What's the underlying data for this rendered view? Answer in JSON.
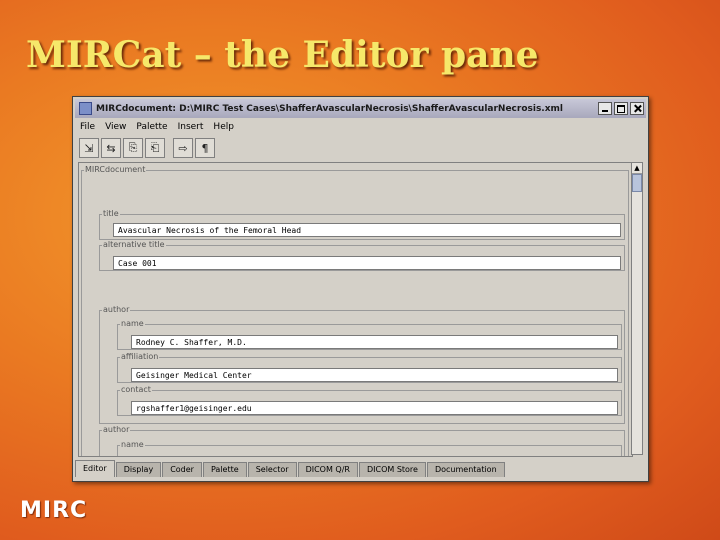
{
  "slide": {
    "title": "MIRCat – the Editor pane",
    "logo": "MIRC"
  },
  "window": {
    "title": "MIRCdocument: D:\\MIRC Test Cases\\ShafferAvascularNecrosis\\ShafferAvascularNecrosis.xml",
    "menus": [
      "File",
      "View",
      "Palette",
      "Insert",
      "Help"
    ],
    "toolbar_icons": [
      "insert-element-icon",
      "move-element-icon",
      "copy-icon",
      "paste-icon",
      "next-icon",
      "paragraph-icon"
    ],
    "toolbar_glyphs": [
      "⇲",
      "⇆",
      "⎘",
      "⎗",
      "⇨",
      "¶"
    ]
  },
  "editor": {
    "root_legend": "MIRCdocument",
    "title_legend": "title",
    "title_value": "Avascular Necrosis of the Femoral Head",
    "alt_title_legend": "alternative title",
    "alt_title_value": "Case 001",
    "author_legend": "author",
    "name_legend": "name",
    "name_value": "Rodney C. Shaffer, M.D.",
    "affiliation_legend": "affiliation",
    "affiliation_value": "Geisinger Medical Center",
    "contact_legend": "contact",
    "contact_value": "rgshaffer1@geisinger.edu",
    "author2_legend": "author",
    "name2_legend": "name"
  },
  "tabs": [
    "Editor",
    "Display",
    "Coder",
    "Palette",
    "Selector",
    "DICOM Q/R",
    "DICOM Store",
    "Documentation"
  ],
  "active_tab": "Editor"
}
